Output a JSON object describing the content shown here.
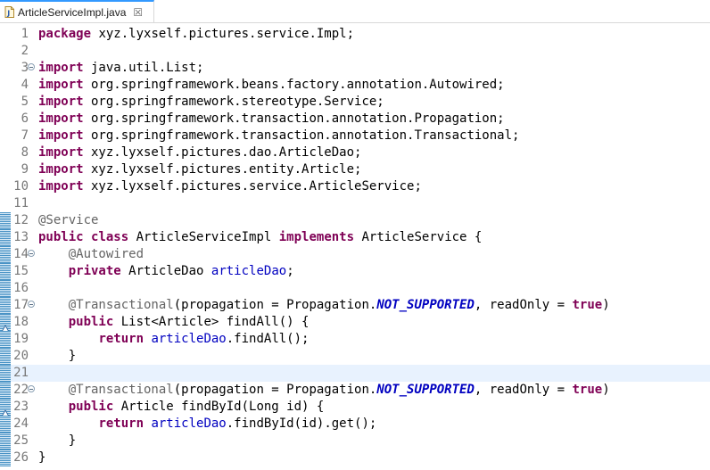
{
  "tab": {
    "title": "ArticleServiceImpl.java",
    "close_glyph": "☒",
    "icon": "java-file-icon"
  },
  "code": {
    "lines": [
      {
        "n": "1",
        "tokens": [
          [
            "kw",
            "package"
          ],
          [
            "t",
            " xyz.lyxself.pictures.service.Impl;"
          ]
        ]
      },
      {
        "n": "2",
        "tokens": []
      },
      {
        "n": "3",
        "fold": true,
        "tokens": [
          [
            "kw",
            "import"
          ],
          [
            "t",
            " java.util.List;"
          ]
        ]
      },
      {
        "n": "4",
        "tokens": [
          [
            "kw",
            "import"
          ],
          [
            "t",
            " org.springframework.beans.factory.annotation.Autowired;"
          ]
        ]
      },
      {
        "n": "5",
        "tokens": [
          [
            "kw",
            "import"
          ],
          [
            "t",
            " org.springframework.stereotype.Service;"
          ]
        ]
      },
      {
        "n": "6",
        "tokens": [
          [
            "kw",
            "import"
          ],
          [
            "t",
            " org.springframework.transaction.annotation.Propagation;"
          ]
        ]
      },
      {
        "n": "7",
        "tokens": [
          [
            "kw",
            "import"
          ],
          [
            "t",
            " org.springframework.transaction.annotation.Transactional;"
          ]
        ]
      },
      {
        "n": "8",
        "tokens": [
          [
            "kw",
            "import"
          ],
          [
            "t",
            " xyz.lyxself.pictures.dao.ArticleDao;"
          ]
        ]
      },
      {
        "n": "9",
        "tokens": [
          [
            "kw",
            "import"
          ],
          [
            "t",
            " xyz.lyxself.pictures.entity.Article;"
          ]
        ]
      },
      {
        "n": "10",
        "tokens": [
          [
            "kw",
            "import"
          ],
          [
            "t",
            " xyz.lyxself.pictures.service.ArticleService;"
          ]
        ]
      },
      {
        "n": "11",
        "tokens": []
      },
      {
        "n": "12",
        "marker": true,
        "tokens": [
          [
            "ann",
            "@Service"
          ]
        ]
      },
      {
        "n": "13",
        "marker": true,
        "tokens": [
          [
            "kw",
            "public"
          ],
          [
            "t",
            " "
          ],
          [
            "kw",
            "class"
          ],
          [
            "t",
            " ArticleServiceImpl "
          ],
          [
            "kw",
            "implements"
          ],
          [
            "t",
            " ArticleService {"
          ]
        ]
      },
      {
        "n": "14",
        "marker": true,
        "fold": true,
        "tokens": [
          [
            "t",
            "    "
          ],
          [
            "ann",
            "@Autowired"
          ]
        ]
      },
      {
        "n": "15",
        "marker": true,
        "tokens": [
          [
            "t",
            "    "
          ],
          [
            "kw",
            "private"
          ],
          [
            "t",
            " ArticleDao "
          ],
          [
            "fld",
            "articleDao"
          ],
          [
            "t",
            ";"
          ]
        ]
      },
      {
        "n": "16",
        "marker": true,
        "tokens": []
      },
      {
        "n": "17",
        "marker": true,
        "fold": true,
        "tokens": [
          [
            "t",
            "    "
          ],
          [
            "ann",
            "@Transactional"
          ],
          [
            "t",
            "(propagation = Propagation."
          ],
          [
            "const",
            "NOT_SUPPORTED"
          ],
          [
            "t",
            ", readOnly = "
          ],
          [
            "kw",
            "true"
          ],
          [
            "t",
            ")"
          ]
        ]
      },
      {
        "n": "18",
        "marker": true,
        "override": true,
        "tokens": [
          [
            "t",
            "    "
          ],
          [
            "kw",
            "public"
          ],
          [
            "t",
            " List<Article> findAll() {"
          ]
        ]
      },
      {
        "n": "19",
        "marker": true,
        "tokens": [
          [
            "t",
            "        "
          ],
          [
            "kw",
            "return"
          ],
          [
            "t",
            " "
          ],
          [
            "fld",
            "articleDao"
          ],
          [
            "t",
            ".findAll();"
          ]
        ]
      },
      {
        "n": "20",
        "marker": true,
        "tokens": [
          [
            "t",
            "    }"
          ]
        ]
      },
      {
        "n": "21",
        "marker": true,
        "current": true,
        "tokens": []
      },
      {
        "n": "22",
        "marker": true,
        "fold": true,
        "tokens": [
          [
            "t",
            "    "
          ],
          [
            "ann",
            "@Transactional"
          ],
          [
            "t",
            "(propagation = Propagation."
          ],
          [
            "const",
            "NOT_SUPPORTED"
          ],
          [
            "t",
            ", readOnly = "
          ],
          [
            "kw",
            "true"
          ],
          [
            "t",
            ")"
          ]
        ]
      },
      {
        "n": "23",
        "marker": true,
        "override": true,
        "tokens": [
          [
            "t",
            "    "
          ],
          [
            "kw",
            "public"
          ],
          [
            "t",
            " Article findById(Long id) {"
          ]
        ]
      },
      {
        "n": "24",
        "marker": true,
        "tokens": [
          [
            "t",
            "        "
          ],
          [
            "kw",
            "return"
          ],
          [
            "t",
            " "
          ],
          [
            "fld",
            "articleDao"
          ],
          [
            "t",
            ".findById(id).get();"
          ]
        ]
      },
      {
        "n": "25",
        "marker": true,
        "tokens": [
          [
            "t",
            "    }"
          ]
        ]
      },
      {
        "n": "26",
        "marker": true,
        "tokens": [
          [
            "t",
            "}"
          ]
        ]
      }
    ]
  }
}
